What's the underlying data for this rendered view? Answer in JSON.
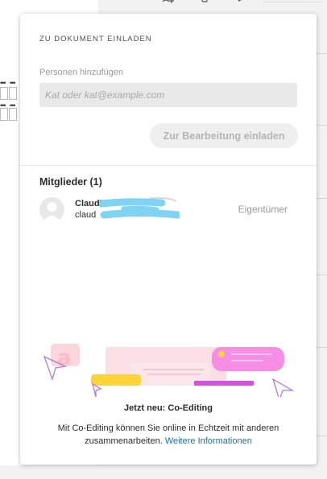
{
  "dialog": {
    "title": "ZU DOKUMENT EINLADEN",
    "field_label": "Personen hinzufügen",
    "input": {
      "value": "",
      "placeholder": "Kat oder kat@example.com"
    },
    "invite_button_label": "Zur Bearbeitung einladen"
  },
  "members": {
    "heading": "Mitglieder (1)",
    "list": [
      {
        "name": "Claudia",
        "email": "claud",
        "role": "Eigentümer",
        "avatar_icon": "user-avatar-icon"
      }
    ]
  },
  "promo": {
    "title": "Jetzt neu: Co-Editing",
    "text": "Mit Co-Editing können Sie online in Echtzeit mit anderen zusammenarbeiten.",
    "link_label": "Weitere Informationen",
    "illustration_icon": "co-editing-illustration"
  },
  "colors": {
    "link": "#1473b5",
    "redaction_scribble": "#7fd3f3",
    "button_disabled_text": "#b4b4b4"
  }
}
